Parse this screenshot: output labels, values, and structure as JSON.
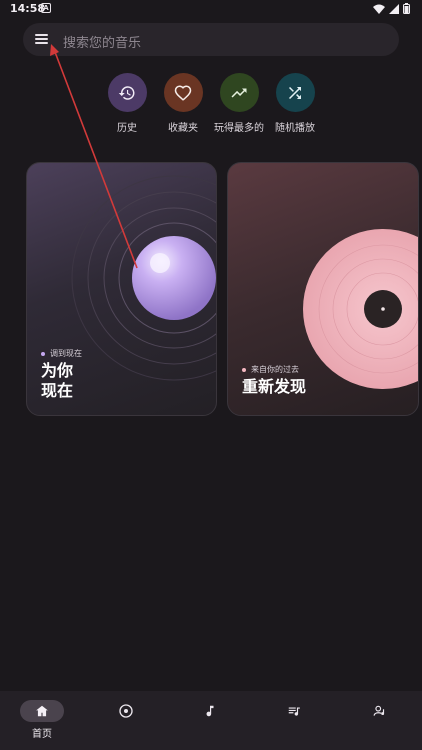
{
  "status_bar": {
    "time": "14:58",
    "notification_badge": "A"
  },
  "search": {
    "placeholder": "搜索您的音乐"
  },
  "quick_actions": [
    {
      "label": "历史",
      "icon": "history-icon",
      "color": "#4c3a66"
    },
    {
      "label": "收藏夹",
      "icon": "heart-icon",
      "color": "#6a3523"
    },
    {
      "label": "玩得最多的",
      "icon": "trending-up-icon",
      "color": "#2f4620"
    },
    {
      "label": "随机播放",
      "icon": "shuffle-icon",
      "color": "#16434d"
    }
  ],
  "cards": [
    {
      "tag": "调到现在",
      "title": "为你\n现在",
      "accent": "#c5a8f0"
    },
    {
      "tag": "来自你的过去",
      "title": "重新发现",
      "accent": "#f3b7c0"
    }
  ],
  "bottom_nav": [
    {
      "label": "首页",
      "icon": "home-icon",
      "active": true
    },
    {
      "label": "",
      "icon": "album-icon",
      "active": false
    },
    {
      "label": "",
      "icon": "music-note-icon",
      "active": false
    },
    {
      "label": "",
      "icon": "playlist-icon",
      "active": false
    },
    {
      "label": "",
      "icon": "artist-icon",
      "active": false
    }
  ],
  "colors": {
    "background": "#1b181c",
    "surface": "#29252b",
    "annotation": "#d23a3a"
  }
}
